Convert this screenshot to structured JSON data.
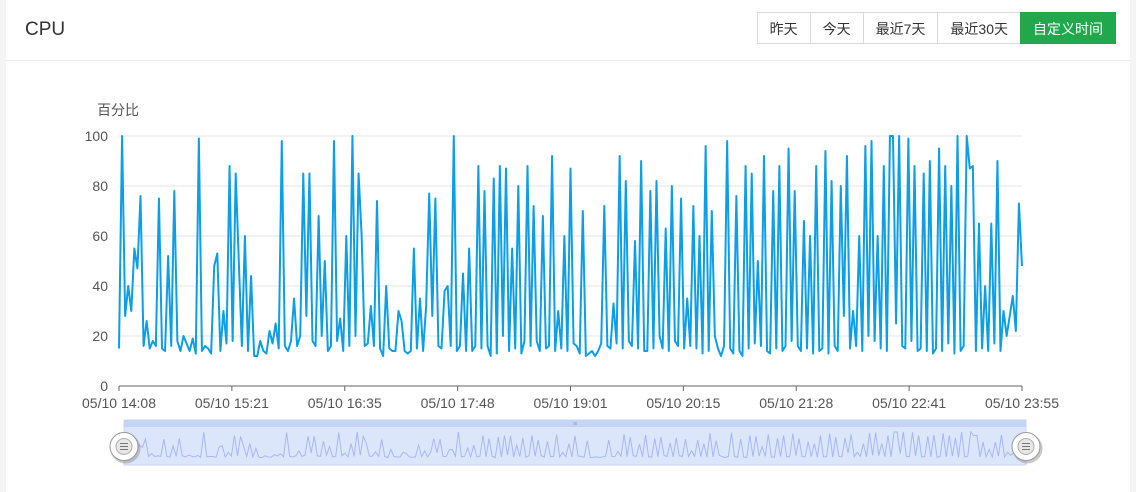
{
  "header": {
    "title": "CPU",
    "range_buttons": [
      {
        "label": "昨天",
        "active": false
      },
      {
        "label": "今天",
        "active": false
      },
      {
        "label": "最近7天",
        "active": false
      },
      {
        "label": "最近30天",
        "active": false
      },
      {
        "label": "自定义时间",
        "active": true
      }
    ]
  },
  "colors": {
    "line": "#0c9ee6",
    "active_button": "#21a84c",
    "grid": "#e6e6e6",
    "slider_fill": "#dbe6fb"
  },
  "chart_data": {
    "type": "line",
    "ylabel": "百分比",
    "ylim": [
      0,
      100
    ],
    "yticks": [
      0,
      20,
      40,
      60,
      80,
      100
    ],
    "xticks": [
      "05/10 14:08",
      "05/10 15:21",
      "05/10 16:35",
      "05/10 17:48",
      "05/10 19:01",
      "05/10 20:15",
      "05/10 21:28",
      "05/10 22:41",
      "05/10 23:55"
    ],
    "x_start": "05/10 14:08",
    "x_end": "05/10 23:55",
    "grid": true,
    "data_zoom": {
      "start": 0,
      "end": 100
    },
    "series": [
      {
        "values": [
          15,
          100,
          28,
          40,
          30,
          55,
          47,
          76,
          16,
          26,
          15,
          18,
          16,
          75,
          15,
          14,
          52,
          16,
          78,
          18,
          14,
          20,
          17,
          14,
          19,
          13,
          99,
          14,
          16,
          15,
          13,
          48,
          53,
          14,
          30,
          17,
          88,
          18,
          85,
          50,
          16,
          60,
          14,
          44,
          12,
          12,
          18,
          14,
          13,
          22,
          17,
          25,
          15,
          98,
          16,
          14,
          18,
          35,
          16,
          20,
          85,
          28,
          85,
          18,
          16,
          68,
          20,
          50,
          14,
          16,
          98,
          18,
          27,
          14,
          60,
          16,
          100,
          20,
          85,
          60,
          16,
          17,
          32,
          16,
          74,
          15,
          12,
          40,
          15,
          14,
          14,
          30,
          26,
          14,
          13,
          14,
          55,
          15,
          35,
          14,
          32,
          77,
          28,
          75,
          16,
          15,
          38,
          40,
          16,
          100,
          14,
          16,
          45,
          14,
          55,
          14,
          16,
          88,
          15,
          78,
          16,
          12,
          83,
          13,
          88,
          20,
          87,
          14,
          55,
          15,
          80,
          13,
          18,
          88,
          16,
          72,
          18,
          14,
          68,
          15,
          16,
          92,
          14,
          30,
          15,
          60,
          14,
          87,
          17,
          16,
          13,
          70,
          12,
          13,
          14,
          12,
          14,
          17,
          72,
          16,
          15,
          33,
          17,
          92,
          15,
          82,
          18,
          16,
          58,
          15,
          90,
          14,
          14,
          78,
          15,
          82,
          20,
          15,
          63,
          14,
          80,
          18,
          16,
          75,
          15,
          35,
          16,
          72,
          15,
          60,
          13,
          96,
          14,
          70,
          20,
          15,
          12,
          16,
          98,
          15,
          13,
          76,
          14,
          12,
          88,
          15,
          85,
          17,
          50,
          16,
          92,
          14,
          13,
          78,
          15,
          88,
          14,
          16,
          95,
          18,
          78,
          16,
          14,
          66,
          15,
          60,
          13,
          88,
          14,
          15,
          94,
          13,
          82,
          16,
          14,
          80,
          28,
          92,
          15,
          30,
          16,
          60,
          14,
          96,
          20,
          98,
          18,
          60,
          15,
          88,
          14,
          100,
          100,
          25,
          100,
          16,
          15,
          99,
          18,
          88,
          14,
          15,
          85,
          14,
          90,
          13,
          15,
          95,
          14,
          88,
          17,
          80,
          13,
          100,
          14,
          16,
          100,
          87,
          88,
          14,
          65,
          15,
          40,
          14,
          65,
          17,
          90,
          14,
          30,
          20,
          28,
          36,
          22,
          73,
          48
        ]
      }
    ]
  }
}
